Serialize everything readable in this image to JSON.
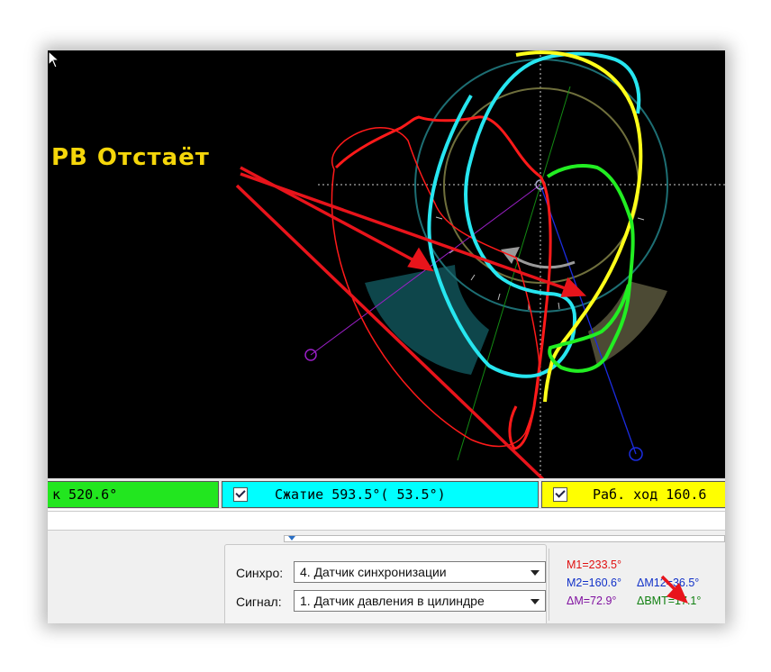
{
  "annotation": {
    "callout_text": "РВ Отстаёт",
    "callout_color": "#f5d60a",
    "arrow_color": "#e8141b"
  },
  "plot": {
    "background": "#000000",
    "trace_colors": {
      "exhaust": "#ff1a1a",
      "compression": "#27e6f0",
      "power_stroke": "#ffff1a",
      "intake": "#22ee22"
    }
  },
  "phases": {
    "intake": {
      "label": "к 520.6°",
      "color": "#22e61f",
      "checked": true
    },
    "compression": {
      "label": "Сжатие 593.5°( 53.5°)",
      "color": "#00ffff",
      "checked": true
    },
    "power": {
      "label": "Раб. ход 160.6",
      "color": "#ffff00",
      "checked": true
    }
  },
  "settings": {
    "sync_label": "Синхро:",
    "sync_value": "4.  Датчик синхронизации",
    "signal_label": "Сигнал:",
    "signal_value": "1.  Датчик давления в цилиндре"
  },
  "markers": {
    "m1": {
      "text": "M1=233.5°",
      "color": "#e01010"
    },
    "m2": {
      "text": "M2=160.6°",
      "color": "#1030c8"
    },
    "dm12": {
      "text": "ΔM12=36.5°",
      "color": "#1030c8"
    },
    "dm": {
      "text": "ΔM=72.9°",
      "color": "#8010a0"
    },
    "dbmt": {
      "text": "ΔBMT=17.1°",
      "color": "#108010"
    }
  }
}
